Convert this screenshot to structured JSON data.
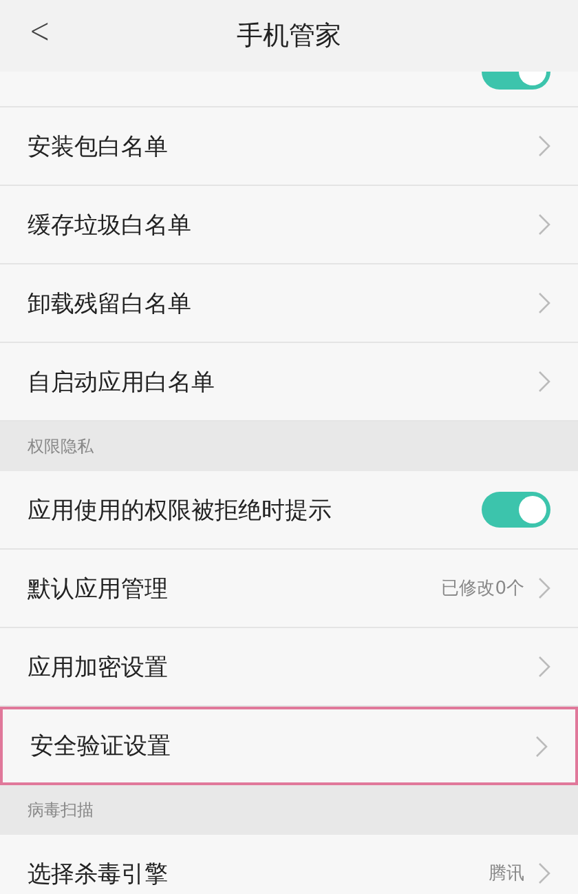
{
  "header": {
    "back": "<",
    "title": "手机管家"
  },
  "items": [
    {
      "kind": "partial_toggle",
      "on": true
    },
    {
      "kind": "link",
      "label": "安装包白名单",
      "highlighted": false
    },
    {
      "kind": "link",
      "label": "缓存垃圾白名单",
      "highlighted": false
    },
    {
      "kind": "link",
      "label": "卸载残留白名单",
      "highlighted": false
    },
    {
      "kind": "link",
      "label": "自启动应用白名单",
      "highlighted": false
    },
    {
      "kind": "section",
      "label": "权限隐私"
    },
    {
      "kind": "toggle",
      "label": "应用使用的权限被拒绝时提示",
      "on": true
    },
    {
      "kind": "link",
      "label": "默认应用管理",
      "value": "已修改0个",
      "highlighted": false
    },
    {
      "kind": "link",
      "label": "应用加密设置",
      "highlighted": false
    },
    {
      "kind": "link",
      "label": "安全验证设置",
      "highlighted": true
    },
    {
      "kind": "section",
      "label": "病毒扫描"
    },
    {
      "kind": "link",
      "label": "选择杀毒引擎",
      "value": "腾讯",
      "highlighted": false
    }
  ]
}
